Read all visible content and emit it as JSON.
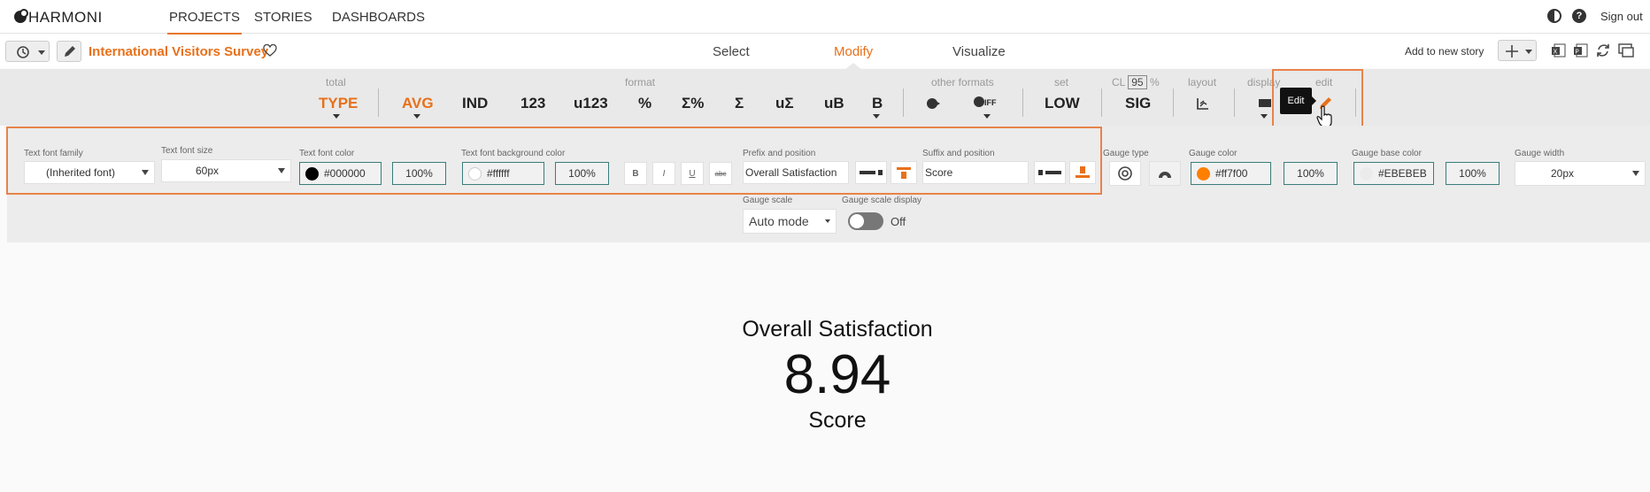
{
  "topnav": {
    "logo": "HARMONI",
    "tabs": [
      {
        "label": "PROJECTS",
        "active": true
      },
      {
        "label": "STORIES",
        "active": false
      },
      {
        "label": "DASHBOARDS",
        "active": false
      }
    ],
    "sign_out": "Sign out",
    "icons": [
      "contrast-icon",
      "help-icon"
    ]
  },
  "projectbar": {
    "title": "International Visitors Survey",
    "modes": [
      {
        "label": "Select",
        "active": false
      },
      {
        "label": "Modify",
        "active": true
      },
      {
        "label": "Visualize",
        "active": false
      }
    ],
    "add_to_story": "Add to new story"
  },
  "toolbar": {
    "groups": {
      "total": "total",
      "format": "format",
      "other_formats": "other formats",
      "set": "set",
      "cl_prefix": "CL",
      "cl_value": "95",
      "cl_suffix": "%",
      "layout": "layout",
      "display": "display",
      "edit": "edit"
    },
    "buttons": {
      "type": "TYPE",
      "avg": "AVG",
      "ind": "IND",
      "n123": "123",
      "u123": "u123",
      "pct": "%",
      "sigma_pct": "Σ%",
      "sigma": "Σ",
      "u_sigma": "uΣ",
      "ub": "uB",
      "b": "B",
      "iff": "IFF",
      "low": "LOW",
      "sig": "SIG"
    },
    "tooltip": "Edit"
  },
  "panel": {
    "text_font_family": {
      "label": "Text font family",
      "value": "(Inherited font)"
    },
    "text_font_size": {
      "label": "Text font size",
      "value": "60px"
    },
    "text_font_color": {
      "label": "Text font color",
      "value": "#000000",
      "opacity": "100%",
      "color": "#000000"
    },
    "text_font_bg_color": {
      "label": "Text font background color",
      "value": "#ffffff",
      "opacity": "100%",
      "color": "#ffffff"
    },
    "style_buttons": {
      "bold": "B",
      "italic": "I",
      "underline": "U",
      "strike": "abc"
    },
    "prefix": {
      "label": "Prefix and position",
      "value": "Overall Satisfaction"
    },
    "suffix": {
      "label": "Suffix and position",
      "value": "Score"
    },
    "gauge_type": {
      "label": "Gauge type"
    },
    "gauge_color": {
      "label": "Gauge color",
      "value": "#ff7f00",
      "opacity": "100%",
      "color": "#ff7f00"
    },
    "gauge_base_color": {
      "label": "Gauge base color",
      "value": "#EBEBEB",
      "opacity": "100%",
      "color": "#EBEBEB"
    },
    "gauge_width": {
      "label": "Gauge width",
      "value": "20px"
    },
    "gauge_scale": {
      "label": "Gauge scale",
      "value": "Auto mode"
    },
    "gauge_scale_display": {
      "label": "Gauge scale display",
      "state": "Off"
    }
  },
  "display": {
    "prefix": "Overall Satisfaction",
    "value": "8.94",
    "suffix": "Score"
  },
  "colors": {
    "accent": "#e8701a",
    "highlight": "#e8834a",
    "teal": "#3a7d7a"
  }
}
